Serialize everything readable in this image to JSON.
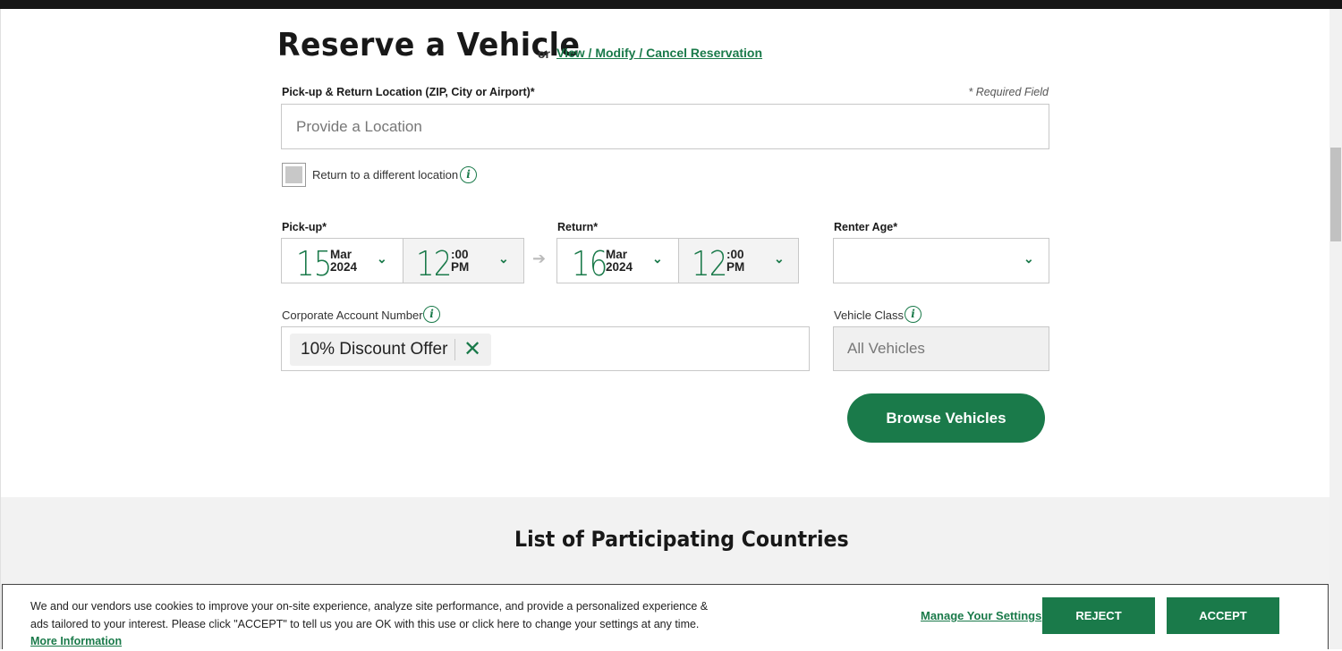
{
  "header": {
    "title": "Reserve a Vehicle",
    "or_text": "or",
    "view_link": "View / Modify / Cancel Reservation"
  },
  "location": {
    "label": "Pick-up & Return Location (ZIP, City or Airport)*",
    "required_note": "* Required Field",
    "placeholder": "Provide a Location",
    "return_different_label": "Return to a different location"
  },
  "pickup": {
    "label": "Pick-up*",
    "day": "15",
    "month": "Mar",
    "year": "2024",
    "hour": "12",
    "minutes": ":00",
    "ampm": "PM"
  },
  "return": {
    "label": "Return*",
    "day": "16",
    "month": "Mar",
    "year": "2024",
    "hour": "12",
    "minutes": ":00",
    "ampm": "PM"
  },
  "renter_age": {
    "label": "Renter Age*",
    "value": ""
  },
  "corporate": {
    "label": "Corporate Account Number",
    "chip_text": "10% Discount Offer"
  },
  "vehicle_class": {
    "label": "Vehicle Class",
    "value": "All Vehicles"
  },
  "browse_button": "Browse Vehicles",
  "countries_title": "List of Participating Countries",
  "cookie": {
    "text": "We and our vendors use cookies to improve your on-site experience, analyze site performance, and provide a personalized experience & ads tailored to your interest. Please click \"ACCEPT\" to tell us you are OK with this use or click here to change your settings at any time.",
    "more_info": "More Information",
    "manage": "Manage Your Settings",
    "reject": "REJECT",
    "accept": "ACCEPT"
  },
  "colors": {
    "accent": "#1a7a4a",
    "topbar": "#161616"
  }
}
